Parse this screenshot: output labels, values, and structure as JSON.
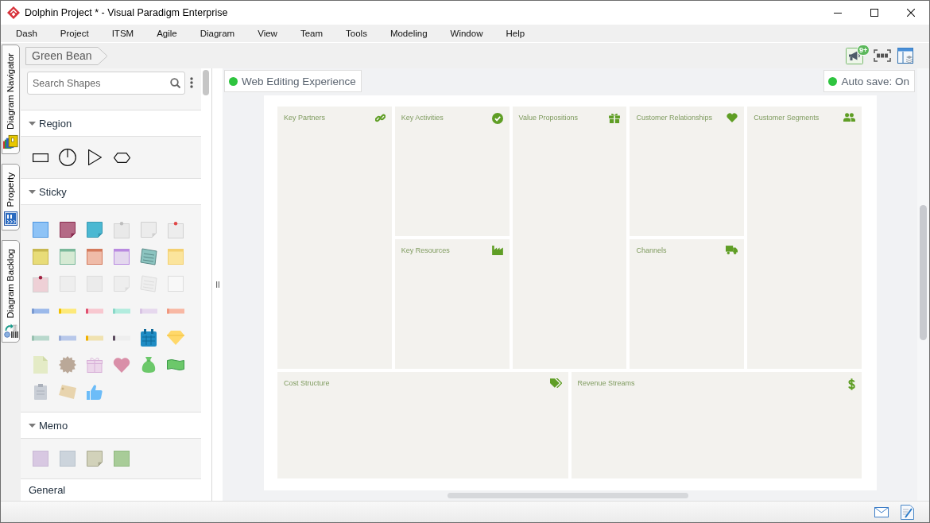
{
  "window": {
    "title": "Dolphin Project * - Visual Paradigm Enterprise"
  },
  "menu": [
    "Dash",
    "Project",
    "ITSM",
    "Agile",
    "Diagram",
    "View",
    "Team",
    "Tools",
    "Modeling",
    "Window",
    "Help"
  ],
  "side_tabs": [
    {
      "label": "Diagram Navigator"
    },
    {
      "label": "Property"
    },
    {
      "label": "Diagram Backlog"
    }
  ],
  "breadcrumb": [
    "Green Bean"
  ],
  "toolbar": {
    "notification_count": "9+"
  },
  "palette": {
    "search": {
      "placeholder": "Search Shapes"
    },
    "sections": [
      {
        "title": "Region",
        "expanded": true
      },
      {
        "title": "Sticky",
        "expanded": true
      },
      {
        "title": "Memo",
        "expanded": true
      },
      {
        "title": "General"
      }
    ]
  },
  "canvas": {
    "badges": [
      {
        "label": "Web Editing Experience",
        "active": true
      },
      {
        "label": "Auto save: On",
        "active": true
      }
    ],
    "blocks": [
      {
        "title": "Key Partners"
      },
      {
        "title": "Key Activities"
      },
      {
        "title": "Value Propositions"
      },
      {
        "title": "Customer Relationships"
      },
      {
        "title": "Customer Segments"
      },
      {
        "title": "Key Resources"
      },
      {
        "title": "Channels"
      },
      {
        "title": "Cost Structure"
      },
      {
        "title": "Revenue Streams"
      }
    ]
  }
}
